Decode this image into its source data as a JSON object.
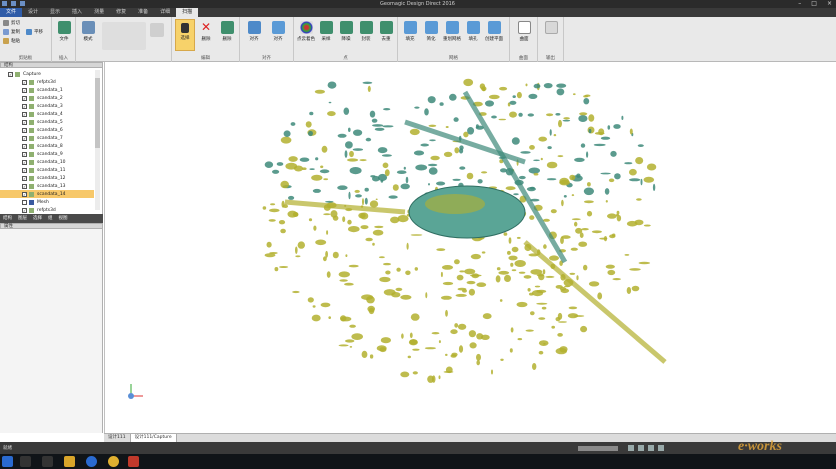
{
  "window": {
    "title": "Geomagic Design Direct 2016"
  },
  "tabs": [
    "文件",
    "设计",
    "显示",
    "插入",
    "测量",
    "修复",
    "准备",
    "详细",
    "扫描"
  ],
  "active_tab": "扫描",
  "ribbon": {
    "clipboard": {
      "label": "剪贴板",
      "items": [
        "剪切",
        "复制",
        "粘贴"
      ]
    },
    "direction": {
      "items": [
        "平移"
      ]
    },
    "file_btn": "文件",
    "mode_btn": "模式",
    "insert_label": "插入",
    "edit": {
      "select": "选择",
      "delete": "删除",
      "delete_area": "删除",
      "label": "编辑"
    },
    "align": {
      "items": [
        "对齐",
        "对齐"
      ],
      "label": "对齐"
    },
    "points": {
      "items": [
        "点云着色",
        "采样",
        "降噪",
        "封装",
        "去重"
      ],
      "label": "点"
    },
    "mesh": {
      "items": [
        "填充",
        "简化",
        "重划网格",
        "填孔",
        "创建平面"
      ],
      "label": "网格"
    },
    "surface": {
      "items": [
        "曲面"
      ],
      "label": "曲面"
    },
    "output": {
      "label": "输出"
    }
  },
  "structure_panel": {
    "title": "结构",
    "items": [
      {
        "label": "Capture",
        "checked": true
      },
      {
        "label": "refpts3d",
        "checked": true
      },
      {
        "label": "scandata_1",
        "checked": true
      },
      {
        "label": "scandata_2",
        "checked": true
      },
      {
        "label": "scandata_3",
        "checked": true
      },
      {
        "label": "scandata_4",
        "checked": true
      },
      {
        "label": "scandata_5",
        "checked": true
      },
      {
        "label": "scandata_6",
        "checked": true
      },
      {
        "label": "scandata_7",
        "checked": true
      },
      {
        "label": "scandata_8",
        "checked": true
      },
      {
        "label": "scandata_9",
        "checked": true
      },
      {
        "label": "scandata_10",
        "checked": true
      },
      {
        "label": "scandata_11",
        "checked": true
      },
      {
        "label": "scandata_12",
        "checked": true
      },
      {
        "label": "scandata_13",
        "checked": true
      },
      {
        "label": "scandata_14",
        "checked": true,
        "selected": true
      },
      {
        "label": "Mesh",
        "checked": false
      },
      {
        "label": "refpts3d",
        "checked": true
      }
    ]
  },
  "mini_tabs": [
    "结构",
    "图层",
    "选择",
    "组",
    "视图"
  ],
  "properties_panel": {
    "title": "属性"
  },
  "doc_tabs": [
    "设计111",
    "设计111/Capture"
  ],
  "status": {
    "text": "就绪"
  },
  "colors": {
    "teal": "#3e8a7a",
    "olive": "#b3b02f",
    "accent": "#2f5ca8"
  }
}
